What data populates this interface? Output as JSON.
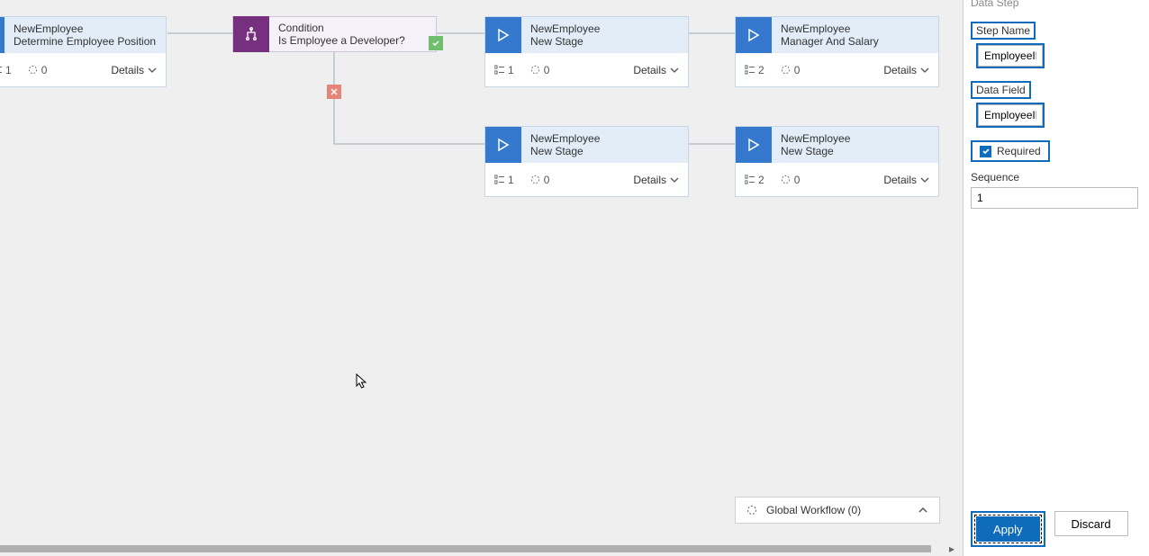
{
  "canvas": {
    "stage1": {
      "top": "NewEmployee",
      "bot": "Determine Employee Position",
      "m1": "1",
      "m2": "0",
      "details": "Details"
    },
    "cond": {
      "top": "Condition",
      "bot": "Is Employee a Developer?"
    },
    "stage3": {
      "top": "NewEmployee",
      "bot": "New Stage",
      "m1": "1",
      "m2": "0",
      "details": "Details"
    },
    "stage4": {
      "top": "NewEmployee",
      "bot": "Manager And Salary",
      "m1": "2",
      "m2": "0",
      "details": "Details"
    },
    "stage5": {
      "top": "NewEmployee",
      "bot": "New Stage",
      "m1": "1",
      "m2": "0",
      "details": "Details"
    },
    "stage6": {
      "top": "NewEmployee",
      "bot": "New Stage",
      "m1": "2",
      "m2": "0",
      "details": "Details"
    },
    "global_workflow": "Global Workflow (0)"
  },
  "panel": {
    "header": "Data Step",
    "step_name_label": "Step Name",
    "step_name_value": "EmployeeID",
    "data_field_label": "Data Field",
    "data_field_value": "EmployeeID",
    "required_label": "Required",
    "sequence_label": "Sequence",
    "sequence_value": "1",
    "apply": "Apply",
    "discard": "Discard"
  }
}
